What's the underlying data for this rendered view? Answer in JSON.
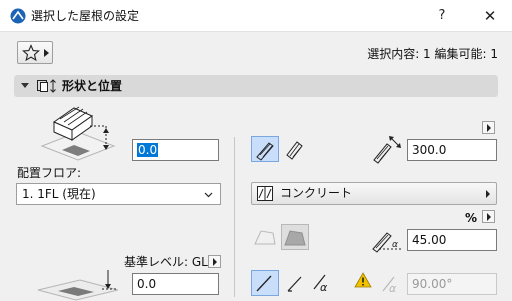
{
  "window": {
    "title": "選択した屋根の設定",
    "help_label": "?",
    "close_label": "✕"
  },
  "toolbar": {
    "favorites_icon": "star-icon",
    "selection_info": "選択内容: 1 編集可能: 1"
  },
  "section": {
    "title": "形状と位置",
    "icon": "shape-position-icon"
  },
  "left": {
    "thickness_value": "0.0",
    "floor_label": "配置フロア:",
    "floor_value": "1. 1FL (現在)",
    "reference_level_label": "基準レベル: GL",
    "offset_value": "0.0"
  },
  "right": {
    "height_value": "300.0",
    "material_label": "コンクリート",
    "percent_label": "%",
    "pitch_value": "45.00",
    "angle_value": "90.00°"
  },
  "colors": {
    "accent": "#0078d7",
    "active_bg": "#c9defa",
    "warning": "#f2c200"
  }
}
